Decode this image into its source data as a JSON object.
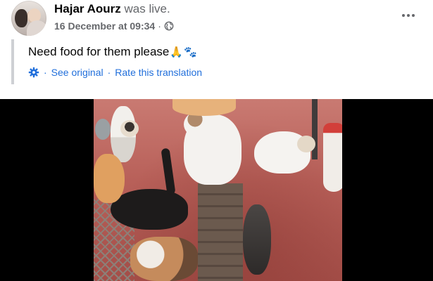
{
  "post": {
    "author_name": "Hajar Aourz",
    "author_status": "was live.",
    "timestamp": "16 December at 09:34",
    "meta_separator": "·",
    "privacy_icon": "globe-icon",
    "more_icon": "more-horizontal-icon"
  },
  "content": {
    "text": "Need food for them please",
    "emojis": [
      "🙏",
      "🐾"
    ]
  },
  "translation": {
    "icon": "gear-icon",
    "separator": "·",
    "see_original": "See original",
    "rate": "Rate this translation"
  },
  "colors": {
    "link": "#216fdb",
    "secondary_text": "#65676b",
    "quote_bar": "#ced0d4",
    "video_letterbox": "#000000"
  }
}
